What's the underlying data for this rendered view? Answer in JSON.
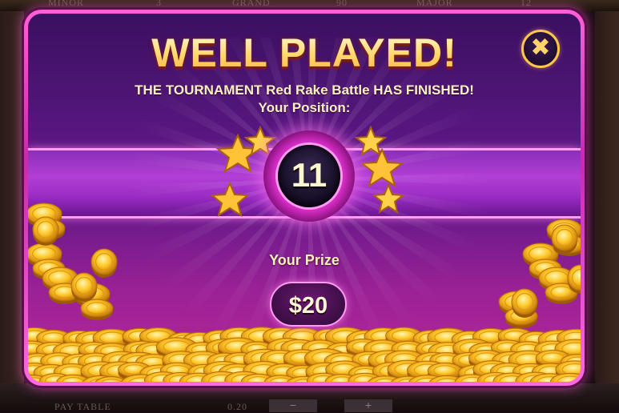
{
  "background": {
    "jackpots": [
      "MINOR",
      "3",
      "GRAND",
      "90",
      "MAJOR",
      "12"
    ],
    "bottom_bar": {
      "pay_table_label": "PAY TABLE",
      "bet_value": "0.20",
      "minus_label": "−",
      "plus_label": "+"
    }
  },
  "popup": {
    "title": "WELL PLAYED!",
    "message": "THE TOURNAMENT Red Rake Battle HAS FINISHED!",
    "position_label": "Your Position:",
    "position_value": "11",
    "prize_label": "Your Prize",
    "prize_amount": "$20",
    "close_icon": "close-icon",
    "decor_icons": [
      "star-icon",
      "coin-icon"
    ]
  },
  "colors": {
    "frame": "#e83ad0",
    "title_gold": "#ffd86a",
    "text_cream": "#fff0c0",
    "close_ring": "#ffc64a"
  }
}
